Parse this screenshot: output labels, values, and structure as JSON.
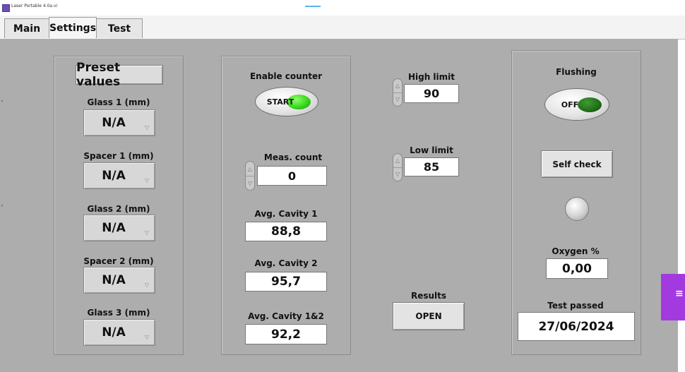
{
  "window": {
    "title": "Laser Portable 4.0a.vi",
    "app_icon": "labview-icon"
  },
  "tabs": [
    {
      "label": "Main",
      "active": false
    },
    {
      "label": "Settings",
      "active": true
    },
    {
      "label": "Test",
      "active": false
    }
  ],
  "presets": {
    "heading": "Preset values",
    "items": [
      {
        "label": "Glass 1 (mm)",
        "value": "N/A"
      },
      {
        "label": "Spacer 1 (mm)",
        "value": "N/A"
      },
      {
        "label": "Glass 2 (mm)",
        "value": "N/A"
      },
      {
        "label": "Spacer 2 (mm)",
        "value": "N/A"
      },
      {
        "label": "Glass 3 (mm)",
        "value": "N/A"
      }
    ]
  },
  "counter": {
    "enable_label": "Enable counter",
    "start_button": "START",
    "start_led_color": "#38d81d",
    "meas_count_label": "Meas. count",
    "meas_count_value": "0",
    "avg_cavity_1_label": "Avg. Cavity 1",
    "avg_cavity_1_value": "88,8",
    "avg_cavity_2_label": "Avg. Cavity 2",
    "avg_cavity_2_value": "95,7",
    "avg_cavity_12_label": "Avg. Cavity 1&2",
    "avg_cavity_12_value": "92,2"
  },
  "limits": {
    "high_label": "High limit",
    "high_value": "90",
    "low_label": "Low limit",
    "low_value": "85"
  },
  "results": {
    "label": "Results",
    "button": "OPEN"
  },
  "flushing": {
    "label": "Flushing",
    "button": "OFF",
    "led_color": "#1f6f18",
    "self_check_button": "Self check",
    "oxygen_label": "Oxygen %",
    "oxygen_value": "0,00",
    "test_passed_label": "Test passed",
    "test_passed_value": "27/06/2024"
  },
  "colors": {
    "panel_background": "#adadad",
    "side_tab": "#a23ae0"
  }
}
